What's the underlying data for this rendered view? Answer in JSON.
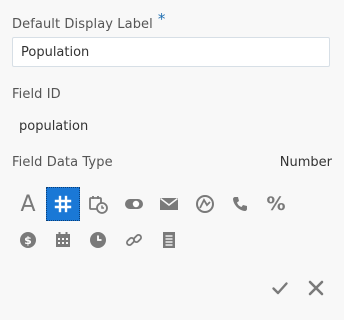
{
  "form": {
    "display_label": "Default Display Label",
    "required_mark": "*",
    "display_value": "Population",
    "field_id_label": "Field ID",
    "field_id_value": "population",
    "data_type_label": "Field Data Type",
    "data_type_value": "Number"
  },
  "type_icons": [
    {
      "name": "text-type-icon",
      "glyph": "A",
      "selected": false
    },
    {
      "name": "number-type-icon",
      "selected": true
    },
    {
      "name": "datetime-type-icon",
      "selected": false
    },
    {
      "name": "boolean-toggle-icon",
      "selected": false
    },
    {
      "name": "email-icon",
      "selected": false
    },
    {
      "name": "geo-icon",
      "selected": false
    },
    {
      "name": "phone-icon",
      "selected": false
    },
    {
      "name": "percent-icon",
      "glyph": "%",
      "selected": false
    },
    {
      "name": "currency-icon",
      "glyph": "$",
      "selected": false
    },
    {
      "name": "date-icon",
      "selected": false
    },
    {
      "name": "time-icon",
      "selected": false
    },
    {
      "name": "link-icon",
      "selected": false
    },
    {
      "name": "document-icon",
      "selected": false
    }
  ],
  "actions": {
    "confirm_icon": "checkmark-icon",
    "cancel_icon": "close-icon"
  },
  "colors": {
    "accent": "#1a78d6",
    "icon_gray": "#7a7a7a",
    "required": "#1f6fb2"
  }
}
